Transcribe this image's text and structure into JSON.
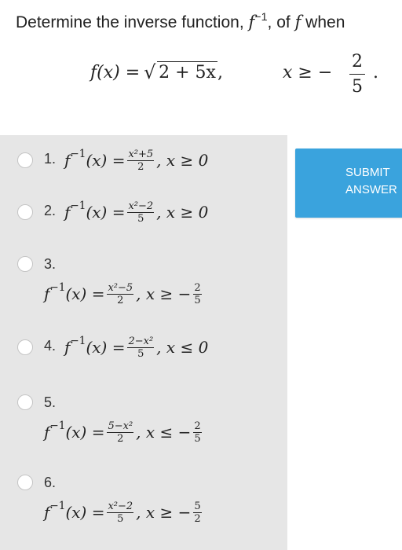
{
  "question": {
    "prefix": "Determine the inverse function, ",
    "inverse_symbol": "f",
    "inverse_exp": "−1",
    "middle": ", of ",
    "f_symbol": "f",
    "suffix": " when",
    "display": {
      "lhs": "f(x) = ",
      "radicand": "2 + 5x",
      "comma": ",",
      "condition": "x ≥ −",
      "frac_num": "2",
      "frac_den": "5",
      "period": "."
    }
  },
  "options": [
    {
      "number": "1.",
      "lhs": "f",
      "exp": "−1",
      "arg": "(x) = ",
      "frac_num": "x²+5",
      "frac_den": "2",
      "cond": ", x ≥ 0",
      "cond_frac_num": "",
      "cond_frac_den": ""
    },
    {
      "number": "2.",
      "lhs": "f",
      "exp": "−1",
      "arg": "(x) = ",
      "frac_num": "x²−2",
      "frac_den": "5",
      "cond": ", x ≥ 0",
      "cond_frac_num": "",
      "cond_frac_den": ""
    },
    {
      "number": "3.",
      "lhs": "f",
      "exp": "−1",
      "arg": "(x) = ",
      "frac_num": "x²−5",
      "frac_den": "2",
      "cond": ", x ≥ −",
      "cond_frac_num": "2",
      "cond_frac_den": "5"
    },
    {
      "number": "4.",
      "lhs": "f",
      "exp": "−1",
      "arg": "(x) = ",
      "frac_num": "2−x²",
      "frac_den": "5",
      "cond": ", x ≤ 0",
      "cond_frac_num": "",
      "cond_frac_den": ""
    },
    {
      "number": "5.",
      "lhs": "f",
      "exp": "−1",
      "arg": "(x) = ",
      "frac_num": "5−x²",
      "frac_den": "2",
      "cond": ", x ≤ −",
      "cond_frac_num": "2",
      "cond_frac_den": "5"
    },
    {
      "number": "6.",
      "lhs": "f",
      "exp": "−1",
      "arg": "(x) = ",
      "frac_num": "x²−2",
      "frac_den": "5",
      "cond": ", x ≥ −",
      "cond_frac_num": "5",
      "cond_frac_den": "2"
    }
  ],
  "submit": {
    "line1": "SUBMIT",
    "line2": "ANSWER"
  },
  "colors": {
    "panel": "#e6e6e6",
    "submit": "#3aa3dd"
  }
}
